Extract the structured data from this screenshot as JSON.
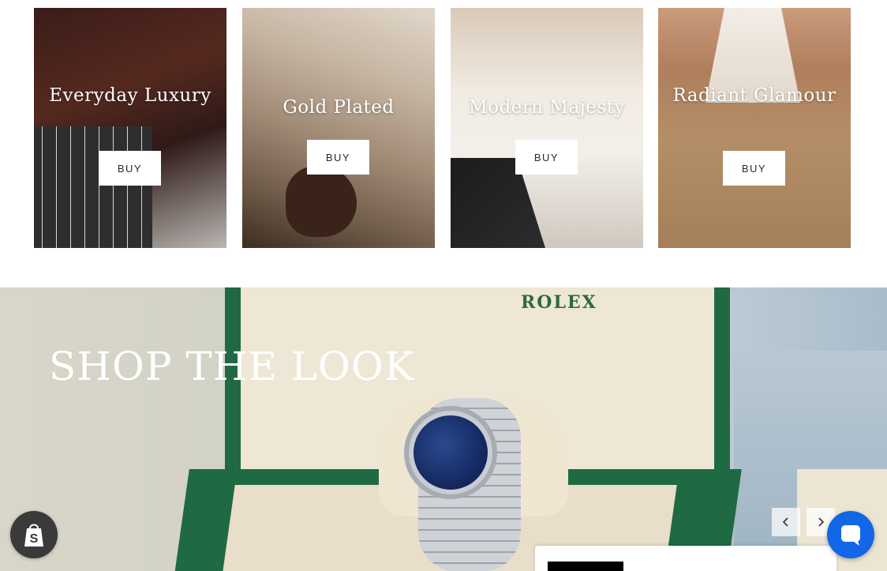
{
  "collections": [
    {
      "title": "Everyday Luxury",
      "buy_label": "BUY"
    },
    {
      "title": "Gold Plated",
      "buy_label": "BUY"
    },
    {
      "title": "Modern Majesty",
      "buy_label": "BUY"
    },
    {
      "title": "Radiant Glamour",
      "buy_label": "BUY"
    }
  ],
  "banner": {
    "title": "SHOP THE LOOK",
    "box_brand": "ROLEX"
  },
  "icons": {
    "prev": "chevron-left-icon",
    "next": "chevron-right-icon",
    "shopify": "shopify-bag-icon",
    "chat": "chat-bubble-icon"
  },
  "colors": {
    "chat_button": "#1266e8",
    "box_green": "#1f6a43",
    "watch_dial": "#13265c"
  }
}
